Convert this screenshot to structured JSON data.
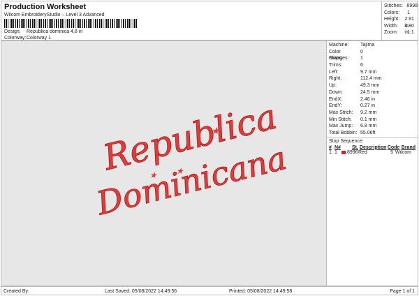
{
  "header": {
    "title": "Production Worksheet",
    "subtitle": "Wilcom EmbroideryStudio – Level 3 Advanced",
    "design_label": "Design:",
    "design_value": "Republica dominica 4,8 in",
    "colorway_label": "Colorway:",
    "colorway_value": "Colorway 1"
  },
  "stats": [
    {
      "label": "Stitches:",
      "value": "8998"
    },
    {
      "label": "Colors:",
      "value": "1"
    },
    {
      "label": "Height:",
      "value": "2.91 in"
    },
    {
      "label": "Width:",
      "value": "4.80 in"
    },
    {
      "label": "Zoom:",
      "value": "1:1"
    }
  ],
  "design": {
    "line1": "Republica",
    "line2": "Dominicana",
    "thread_color": "#e03a3a"
  },
  "details": [
    {
      "label": "Machine:",
      "value": "Tajima"
    },
    {
      "label": "Color changes:",
      "value": "0"
    },
    {
      "label": "Stops:",
      "value": "1"
    },
    {
      "label": "Trims:",
      "value": "6"
    },
    {
      "label": "Left:",
      "value": "9.7 mm"
    },
    {
      "label": "Right:",
      "value": "112.4 mm"
    },
    {
      "label": "Up:",
      "value": "49.3 mm"
    },
    {
      "label": "Down:",
      "value": "24.5 mm"
    },
    {
      "label": "EndX:",
      "value": "2.46 in"
    },
    {
      "label": "EndY:",
      "value": "0.27 in"
    },
    {
      "label": "Max Stitch:",
      "value": "9.2 mm"
    },
    {
      "label": "Min Stitch:",
      "value": "0.1 mm"
    },
    {
      "label": "Max Jump:",
      "value": "6.8 mm"
    },
    {
      "label": "Total Bobbin:",
      "value": "55.06ft"
    }
  ],
  "sequence": {
    "title": "Stop Sequence:",
    "headers": [
      "#",
      "N#",
      "St.",
      "Description",
      "Code",
      "Brand"
    ],
    "rows": [
      {
        "num": "1.",
        "n": "1",
        "color": "#e02020",
        "st": "8996",
        "desc": "Red",
        "code": "5",
        "brand": "Wilcom"
      }
    ]
  },
  "footer": {
    "created": "Created By:",
    "saved": "Last Saved: 05/08/2022 14:49:56",
    "printed": "Printed: 05/08/2022 14:49:58",
    "page": "Page 1 of 1"
  }
}
